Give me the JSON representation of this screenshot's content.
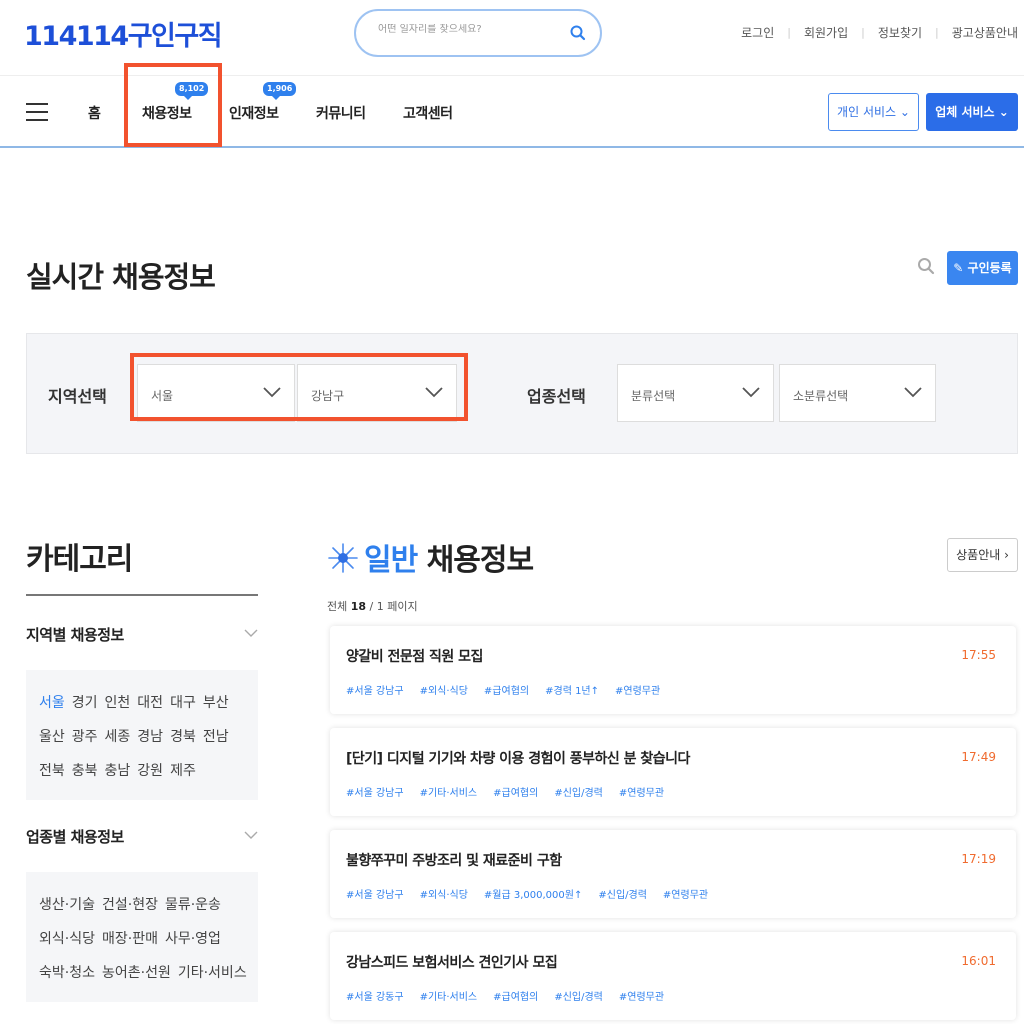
{
  "header": {
    "logo": "114114구인구직",
    "search_placeholder": "어떤 일자리를 찾으세요?",
    "util_links": [
      "로그인",
      "회원가입",
      "정보찾기",
      "광고상품안내"
    ]
  },
  "nav": {
    "items": [
      {
        "label": "홈",
        "badge": ""
      },
      {
        "label": "채용정보",
        "badge": "8,102"
      },
      {
        "label": "인재정보",
        "badge": "1,906"
      },
      {
        "label": "커뮤니티",
        "badge": ""
      },
      {
        "label": "고객센터",
        "badge": ""
      }
    ],
    "personal_service": "개인 서비스 ⌄",
    "company_service": "업체 서비스 ⌄"
  },
  "page": {
    "title": "실시간 채용정보",
    "register_button": "✎ 구인등록"
  },
  "filter": {
    "region_label": "지역선택",
    "region_value": "서울",
    "district_value": "강남구",
    "industry_label": "업종선택",
    "category_value": "분류선택",
    "subcategory_value": "소분류선택"
  },
  "sidebar": {
    "title": "카테고리",
    "region_heading": "지역별 채용정보",
    "region_rows": [
      [
        "서울",
        "경기",
        "인천",
        "대전",
        "대구",
        "부산"
      ],
      [
        "울산",
        "광주",
        "세종",
        "경남",
        "경북",
        "전남"
      ],
      [
        "전북",
        "충북",
        "충남",
        "강원",
        "제주"
      ]
    ],
    "industry_heading": "업종별 채용정보",
    "industry_rows": [
      [
        "생산·기술",
        "건설·현장",
        "물류·운송"
      ],
      [
        "외식·식당",
        "매장·판매",
        "사무·영업"
      ],
      [
        "숙박·청소",
        "농어촌·선원",
        "기타·서비스"
      ]
    ]
  },
  "jobs": {
    "title_highlight": "일반",
    "title_rest": " 채용정보",
    "product_button": "상품안내 ›",
    "count_prefix": "전체 ",
    "count_total": "18",
    "count_suffix": " / 1 페이지",
    "list": [
      {
        "title": "양갈비 전문점 직원 모집",
        "time": "17:55",
        "tags": [
          "#서울 강남구",
          "#외식·식당",
          "#급여협의",
          "#경력 1년↑",
          "#연령무관"
        ]
      },
      {
        "title": "[단기] 디지털 기기와 차량 이용 경험이 풍부하신 분 찾습니다",
        "time": "17:49",
        "tags": [
          "#서울 강남구",
          "#기타·서비스",
          "#급여협의",
          "#신입/경력",
          "#연령무관"
        ]
      },
      {
        "title": "불향쭈꾸미 주방조리 및 재료준비 구함",
        "time": "17:19",
        "tags": [
          "#서울 강남구",
          "#외식·식당",
          "#월급 3,000,000원↑",
          "#신입/경력",
          "#연령무관"
        ]
      },
      {
        "title": "강남스피드 보험서비스 견인기사 모집",
        "time": "16:01",
        "tags": [
          "#서울 강동구",
          "#기타·서비스",
          "#급여협의",
          "#신입/경력",
          "#연령무관"
        ]
      }
    ]
  },
  "colors": {
    "accent": "#2f80ed",
    "highlight": "#f2522e",
    "time": "#f06b2f"
  }
}
